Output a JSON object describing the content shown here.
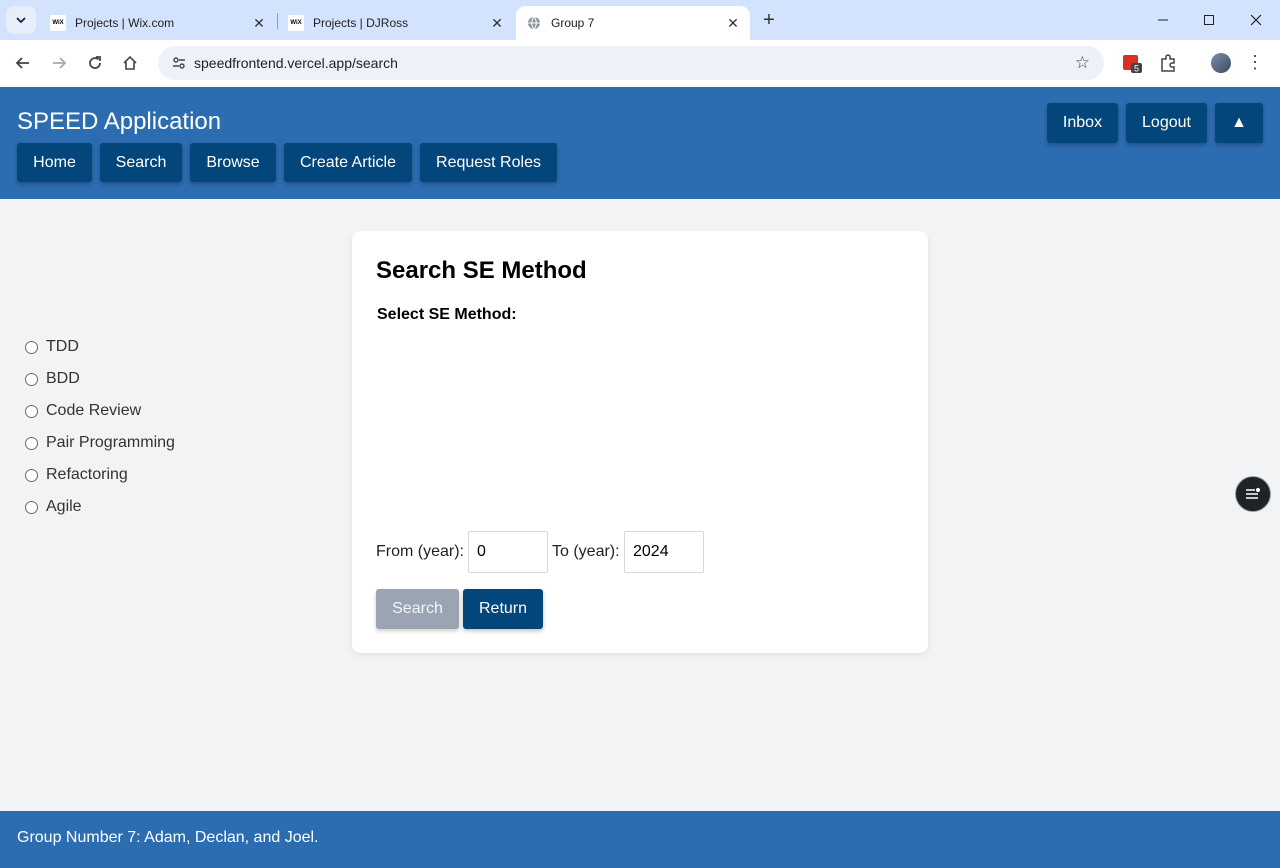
{
  "browser": {
    "tabs": [
      {
        "title": "Projects | Wix.com",
        "favicon": "WiX"
      },
      {
        "title": "Projects | DJRoss",
        "favicon": "WiX"
      },
      {
        "title": "Group 7",
        "favicon": "globe-icon"
      }
    ],
    "url": "speedfrontend.vercel.app/search",
    "extension_badge": "5"
  },
  "app": {
    "title": "SPEED Application",
    "nav": [
      "Home",
      "Search",
      "Browse",
      "Create Article",
      "Request Roles"
    ],
    "right_buttons": {
      "inbox": "Inbox",
      "logout": "Logout",
      "scroll_top": "▲"
    }
  },
  "search_form": {
    "title": "Search SE Method",
    "method_label": "Select SE Method:",
    "methods": [
      "TDD",
      "BDD",
      "Code Review",
      "Pair Programming",
      "Refactoring",
      "Agile"
    ],
    "from_label": "From (year):",
    "from_value": "0",
    "to_label": "To (year):",
    "to_value": "2024",
    "search_button": "Search",
    "return_button": "Return"
  },
  "footer": {
    "text": "Group Number 7: Adam, Declan, and Joel."
  },
  "colors": {
    "header_bg": "#2c6cb0",
    "button_dark": "#02467c",
    "disabled_button": "#9aa4b2",
    "page_bg": "#f2f3f5"
  }
}
